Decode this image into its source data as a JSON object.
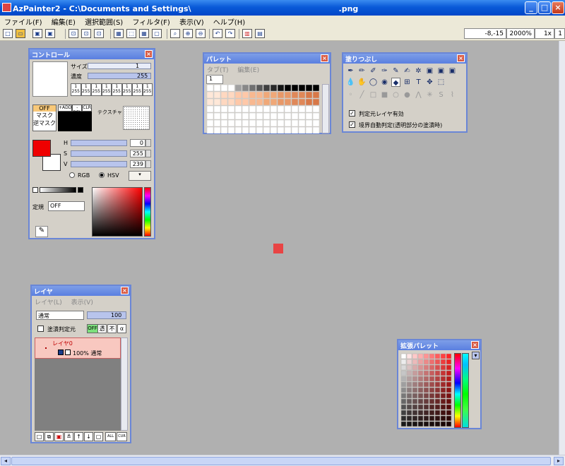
{
  "window": {
    "title": "AzPainter2 - C:\\Documents and Settings\\　　　　　　　　　　　　　　　　　　　.png",
    "min_label": "_",
    "max_label": "□",
    "close_label": "×"
  },
  "menu": [
    {
      "label": "ファイル(F)"
    },
    {
      "label": "編集(E)"
    },
    {
      "label": "選択範囲(S)"
    },
    {
      "label": "フィルタ(F)"
    },
    {
      "label": "表示(V)"
    },
    {
      "label": "ヘルプ(H)"
    }
  ],
  "status": {
    "coords": "-8,-15",
    "zoom": "2000%",
    "scale": "1x",
    "extra": "1"
  },
  "control": {
    "title": "コントロール",
    "size_label": "サイズ",
    "size_value": "1",
    "density_label": "濃度",
    "density_value": "255",
    "mini_values": [
      "1\n255",
      "1\n255",
      "1\n255",
      "1\n255",
      "1\n255",
      "1\n255",
      "1\n255",
      "1\n255"
    ],
    "mode_off": "OFF",
    "mode_mask": "マスク",
    "mode_inv_mask": "逆マスク",
    "btn_add": "+ADD",
    "btn_del": "-DEL",
    "btn_clr": "CLR",
    "texture_label": "テクスチャ",
    "h_label": "H",
    "h_value": "0",
    "s_label": "S",
    "s_value": "255",
    "v_label": "V",
    "v_value": "239",
    "rgb_label": "RGB",
    "hsv_label": "HSV",
    "teiki_label": "定規",
    "teiki_value": "OFF",
    "fg_color": "#ef0000",
    "bg_color": "#ffffff"
  },
  "palette": {
    "title": "パレット",
    "menu_tab": "タブ(T)",
    "menu_edit": "編集(E)",
    "tab1": "1"
  },
  "fill": {
    "title": "塗りつぶし",
    "opt1": "判定元レイヤ有効",
    "opt2": "境界自動判定(透明部分の塗潰時)"
  },
  "layer": {
    "title": "レイヤ",
    "menu_layer": "レイヤ(L)",
    "menu_view": "表示(V)",
    "blend": "通常",
    "opacity": "100",
    "fill_ref_label": "塗潰判定元",
    "btn_off": "OFF",
    "btn_trans": "透",
    "btn_not": "不",
    "btn_alpha": "α",
    "layer_name": "レイヤ0",
    "layer_info": "100% 通常",
    "btn_all": "ALL",
    "btn_cur": "CUR"
  },
  "ext_palette": {
    "title": "拡張パレット"
  }
}
